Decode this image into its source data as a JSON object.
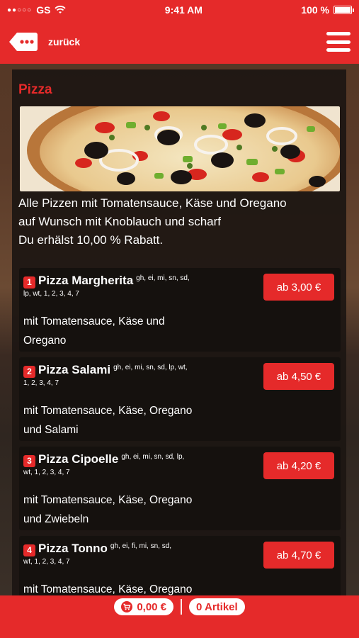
{
  "status": {
    "carrier": "GS",
    "time": "9:41 AM",
    "battery": "100 %",
    "battery_level": 1.0
  },
  "nav": {
    "back_label": "zurück"
  },
  "category": {
    "title": "Pizza",
    "intro_lines": [
      "Alle Pizzen mit Tomatensauce, Käse und Oregano",
      "auf Wunsch mit Knoblauch und scharf",
      "Du erhälst 10,00 % Rabatt."
    ]
  },
  "items": [
    {
      "number": "1",
      "name": "Pizza Margherita",
      "allergens_1": "gh, ei, mi, sn, sd,",
      "allergens_2": "lp, wt, 1, 2, 3, 4, 7",
      "desc_1": "mit Tomatensauce, Käse und",
      "desc_2": "Oregano",
      "price": "ab 3,00 €"
    },
    {
      "number": "2",
      "name": "Pizza Salami",
      "allergens_1": "gh, ei, mi, sn, sd, lp, wt,",
      "allergens_2": "1, 2, 3, 4, 7",
      "desc_1": "mit Tomatensauce, Käse, Oregano",
      "desc_2": "und Salami",
      "price": "ab 4,50 €"
    },
    {
      "number": "3",
      "name": "Pizza Cipoelle",
      "allergens_1": "gh, ei, mi, sn, sd, lp,",
      "allergens_2": "wt, 1, 2, 3, 4, 7",
      "desc_1": "mit Tomatensauce, Käse, Oregano",
      "desc_2": "und Zwiebeln",
      "price": "ab 4,20 €"
    },
    {
      "number": "4",
      "name": "Pizza Tonno",
      "allergens_1": "gh, ei, fi, mi, sn, sd,",
      "allergens_2": "wt, 1, 2, 3, 4, 7",
      "desc_1": "mit Tomatensauce, Käse, Oregano",
      "desc_2": "",
      "price": "ab 4,70 €"
    }
  ],
  "cart": {
    "total": "0,00 €",
    "articles": "0 Artikel"
  },
  "colors": {
    "accent": "#e52a2a",
    "panel": "#1c1612",
    "card": "#15110e"
  },
  "icons": {
    "back": "back-bubble-icon",
    "menu": "hamburger-icon",
    "cart": "cart-icon",
    "wifi": "wifi-icon",
    "battery": "battery-icon"
  }
}
